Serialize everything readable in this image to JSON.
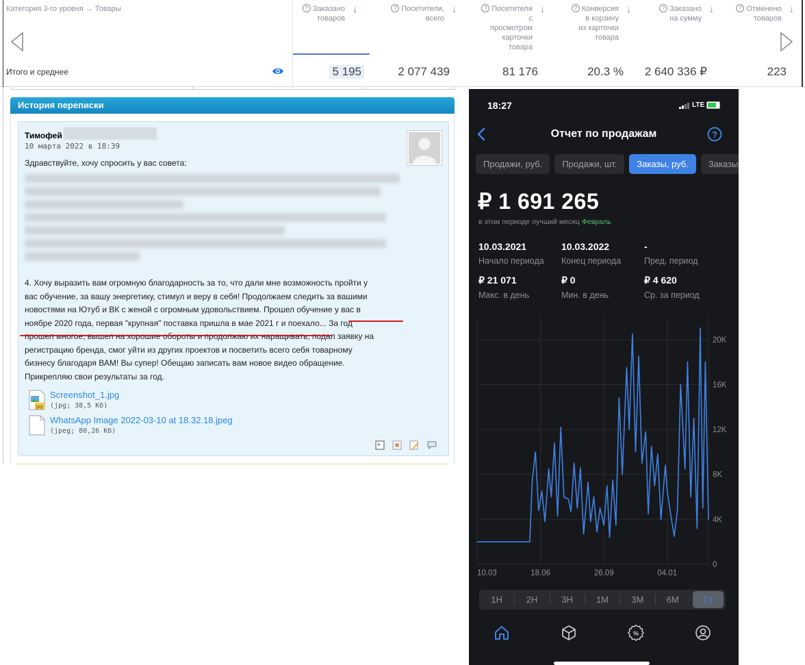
{
  "analytics": {
    "category_label": "Категория 3-го уровня → Товары",
    "columns": [
      {
        "label": "Заказано товаров",
        "lines": [
          "Заказано",
          "товаров"
        ]
      },
      {
        "label": "Посетители, всего",
        "lines": [
          "Посетители,",
          "всего"
        ]
      },
      {
        "label": "Посетители с просмотром карточки товара",
        "lines": [
          "Посетители",
          "с",
          "просмотром",
          "карточки",
          "товара"
        ]
      },
      {
        "label": "Конверсия в корзину из карточки товара",
        "lines": [
          "Конверсия",
          "в корзину",
          "из карточки",
          "товара"
        ]
      },
      {
        "label": "Заказано на сумму",
        "lines": [
          "Заказано",
          "на сумму"
        ]
      },
      {
        "label": "Отменено товаров",
        "lines": [
          "Отменено",
          "товаров"
        ]
      }
    ],
    "total_label": "Итого и среднее",
    "values": [
      "5 195",
      "2 077 439",
      "81 176",
      "20.3 %",
      "2 640 336 ₽",
      "223"
    ]
  },
  "forum": {
    "thread_title": "История переписки",
    "post": {
      "author": "Тимофей",
      "date": "10 марта 2022 в 18:39",
      "greeting": "Здравствуйте, хочу спросить у вас совета:",
      "para_lines": [
        "4. Хочу выразить вам огромную благодарность за то, что дали мне возможность пройти у",
        "вас обучение, за вашу энергетику, стимул и веру в себя! Продолжаем следить за вашими",
        "новостями на Ютуб и ВК с женой с огромным удовольствием. Прошел обучение у вас в",
        "ноябре 2020 года, первая \"крупная\" поставка пришла в мае 2021 г и поехало... За год",
        "прошел многое, вышел на хорошие обороты и продолжаю их наращивать, подал заявку на",
        "регистрацию бренда, смог уйти из других проектов и посветить всего себя товарному",
        "бизнесу благодаря ВАМ! Вы супер! Обещаю записать вам новое видео обращение.",
        "Прикрепляю свои результаты за год."
      ],
      "attachments": [
        {
          "name": "Screenshot_1.jpg",
          "meta": "(jpg; 38,5 Кб)",
          "badge": "jpg"
        },
        {
          "name": "WhatsApp Image 2022-03-10 at 18.32.18.jpeg",
          "meta": "(jpeg; 80,26 Кб)",
          "badge": ""
        }
      ]
    }
  },
  "phone": {
    "time": "18:27",
    "network": "LTE",
    "title": "Отчет по продажам",
    "chips": [
      "Продажи, руб.",
      "Продажи, шт.",
      "Заказы, руб.",
      "Заказы"
    ],
    "active_chip": 2,
    "total": "₽ 1 691 265",
    "best_month_prefix": "в этом периоде лучший месяц",
    "best_month": "Февраль",
    "stats": [
      {
        "value": "10.03.2021",
        "label": "Начало периода"
      },
      {
        "value": "10.03.2022",
        "label": "Конец периода"
      },
      {
        "value": "-",
        "label": "Пред. период"
      },
      {
        "value": "₽ 21 071",
        "label": "Макс. в день"
      },
      {
        "value": "₽ 0",
        "label": "Мин. в день"
      },
      {
        "value": "₽ 4 620",
        "label": "Ср. за период"
      }
    ],
    "ranges": [
      "1H",
      "2H",
      "3H",
      "1M",
      "3M",
      "6M",
      "1Y"
    ],
    "selected_range": 6,
    "accent": "#3f82e6"
  },
  "chart_data": {
    "type": "line",
    "x_ticks": [
      "10.03",
      "18.06",
      "26.09",
      "04.01"
    ],
    "y_ticks": [
      "0",
      "4K",
      "8K",
      "12K",
      "16K",
      "20K"
    ],
    "ylim": [
      0,
      22000
    ],
    "series": [
      {
        "color": "#3f82e6",
        "x": [
          "2021-03-10",
          "2021-03-25",
          "2021-04-10",
          "2021-04-25",
          "2021-05-10",
          "2021-05-20",
          "2021-05-25",
          "2021-06-01",
          "2021-06-05",
          "2021-06-10",
          "2021-06-15",
          "2021-06-20",
          "2021-06-25",
          "2021-07-01",
          "2021-07-05",
          "2021-07-10",
          "2021-07-15",
          "2021-07-20",
          "2021-07-25",
          "2021-08-01",
          "2021-08-05",
          "2021-08-10",
          "2021-08-15",
          "2021-08-20",
          "2021-08-25",
          "2021-09-01",
          "2021-09-05",
          "2021-09-10",
          "2021-09-15",
          "2021-09-20",
          "2021-09-26",
          "2021-10-01",
          "2021-10-05",
          "2021-10-10",
          "2021-10-15",
          "2021-10-20",
          "2021-10-25",
          "2021-11-01",
          "2021-11-05",
          "2021-11-10",
          "2021-11-15",
          "2021-11-20",
          "2021-11-25",
          "2021-12-01",
          "2021-12-05",
          "2021-12-10",
          "2021-12-15",
          "2021-12-20",
          "2021-12-25",
          "2022-01-01",
          "2022-01-04",
          "2022-01-10",
          "2022-01-15",
          "2022-01-20",
          "2022-01-25",
          "2022-02-01",
          "2022-02-05",
          "2022-02-10",
          "2022-02-15",
          "2022-02-20",
          "2022-02-25",
          "2022-03-01",
          "2022-03-05",
          "2022-03-10"
        ],
        "values": [
          2000,
          2000,
          2000,
          2000,
          2000,
          2000,
          2000,
          2000,
          7500,
          10000,
          4800,
          6500,
          3800,
          8500,
          6000,
          10800,
          4300,
          12200,
          6000,
          5800,
          4700,
          9000,
          5000,
          8600,
          2700,
          7300,
          3800,
          6000,
          2900,
          5000,
          3500,
          7000,
          2400,
          7500,
          3500,
          14800,
          8000,
          17500,
          12000,
          20500,
          10000,
          18500,
          9000,
          11800,
          4500,
          10500,
          7000,
          9800,
          4000,
          8800,
          6500,
          4200,
          2500,
          4800,
          16000,
          8500,
          18000,
          6000,
          13000,
          3200,
          21000,
          5000,
          18000,
          4000
        ]
      }
    ]
  }
}
